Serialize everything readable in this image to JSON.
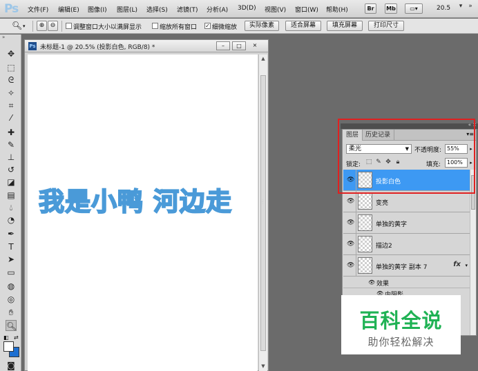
{
  "app": {
    "logo": "Ps",
    "menu": [
      "文件(F)",
      "编辑(E)",
      "图像(I)",
      "图层(L)",
      "选择(S)",
      "滤镜(T)",
      "分析(A)",
      "3D(D)",
      "视图(V)",
      "窗口(W)",
      "帮助(H)"
    ],
    "bridge_label": "Br",
    "minibridge_label": "Mb",
    "zoom": "20.5",
    "window_controls": [
      "–",
      "□",
      "×"
    ]
  },
  "options": {
    "checkboxes": [
      {
        "label": "调整窗口大小以满屏显示",
        "checked": false
      },
      {
        "label": "缩放所有窗口",
        "checked": false
      },
      {
        "label": "细微缩放",
        "checked": true
      }
    ],
    "buttons": [
      "实际像素",
      "适合屏幕",
      "填充屏幕",
      "打印尺寸"
    ]
  },
  "document": {
    "title": "未标题-1 @ 20.5% (投影白色, RGB/8) *",
    "art_text_1": "我是小鸭",
    "art_text_2": "河边走"
  },
  "layers_panel": {
    "tabs": [
      "图层",
      "历史记录"
    ],
    "blend_mode": "柔光",
    "opacity_label": "不透明度:",
    "opacity": "55%",
    "lock_label": "锁定:",
    "fill_label": "填充:",
    "fill": "100%",
    "layers": [
      {
        "name": "投影白色",
        "selected": true
      },
      {
        "name": "变亮",
        "selected": false
      },
      {
        "name": "单独的黄字",
        "selected": false
      },
      {
        "name": "描边2",
        "selected": false
      },
      {
        "name": "单独的黄字 副本 7",
        "selected": false,
        "has_fx": true
      }
    ],
    "fx_label": "fx",
    "effects_label": "效果",
    "effect_items": [
      "内阴影"
    ]
  },
  "watermark": {
    "title": "百科全说",
    "subtitle": "助你轻松解决"
  }
}
